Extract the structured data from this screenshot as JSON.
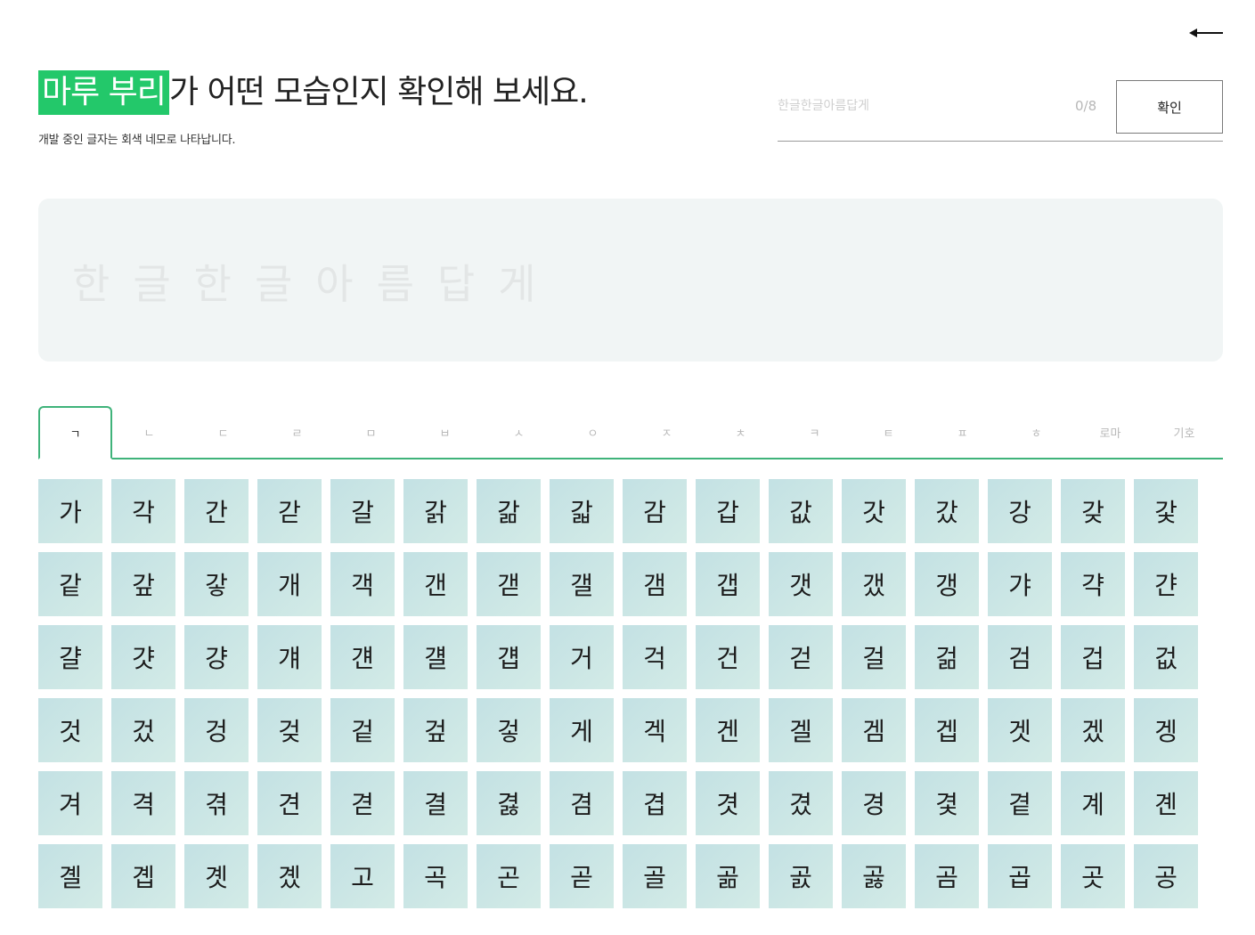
{
  "header": {
    "highlight": "마루 부리",
    "title_rest": "가 어떤 모습인지 확인해 보세요.",
    "subtitle": "개발 중인 글자는 회색 네모로 나타납니다."
  },
  "input": {
    "placeholder": "한글한글아름답게",
    "value": "",
    "counter": "0/8",
    "confirm_label": "확인"
  },
  "preview": {
    "text": "한글한글아름답게"
  },
  "tabs": [
    {
      "label": "ㄱ",
      "active": true
    },
    {
      "label": "ㄴ"
    },
    {
      "label": "ㄷ"
    },
    {
      "label": "ㄹ"
    },
    {
      "label": "ㅁ"
    },
    {
      "label": "ㅂ"
    },
    {
      "label": "ㅅ"
    },
    {
      "label": "ㅇ"
    },
    {
      "label": "ㅈ"
    },
    {
      "label": "ㅊ"
    },
    {
      "label": "ㅋ"
    },
    {
      "label": "ㅌ"
    },
    {
      "label": "ㅍ"
    },
    {
      "label": "ㅎ"
    },
    {
      "label": "로마"
    },
    {
      "label": "기호"
    }
  ],
  "glyphs": [
    "가",
    "각",
    "간",
    "갇",
    "갈",
    "갉",
    "갊",
    "갋",
    "감",
    "갑",
    "값",
    "갓",
    "갔",
    "강",
    "갖",
    "갗",
    "같",
    "갚",
    "갛",
    "개",
    "객",
    "갠",
    "갣",
    "갤",
    "갬",
    "갭",
    "갯",
    "갰",
    "갱",
    "갸",
    "갹",
    "갼",
    "걀",
    "걋",
    "걍",
    "걔",
    "걘",
    "걜",
    "걥",
    "거",
    "걱",
    "건",
    "걷",
    "걸",
    "걺",
    "검",
    "겁",
    "겂",
    "것",
    "겄",
    "겅",
    "겆",
    "겉",
    "겊",
    "겋",
    "게",
    "겍",
    "겐",
    "겔",
    "겜",
    "겝",
    "겟",
    "겠",
    "겡",
    "겨",
    "격",
    "겪",
    "견",
    "겯",
    "결",
    "겷",
    "겸",
    "겹",
    "겻",
    "겼",
    "경",
    "겿",
    "곁",
    "계",
    "곈",
    "곌",
    "곕",
    "곗",
    "곘",
    "고",
    "곡",
    "곤",
    "곧",
    "골",
    "곪",
    "곬",
    "곯",
    "곰",
    "곱",
    "곳",
    "공"
  ]
}
